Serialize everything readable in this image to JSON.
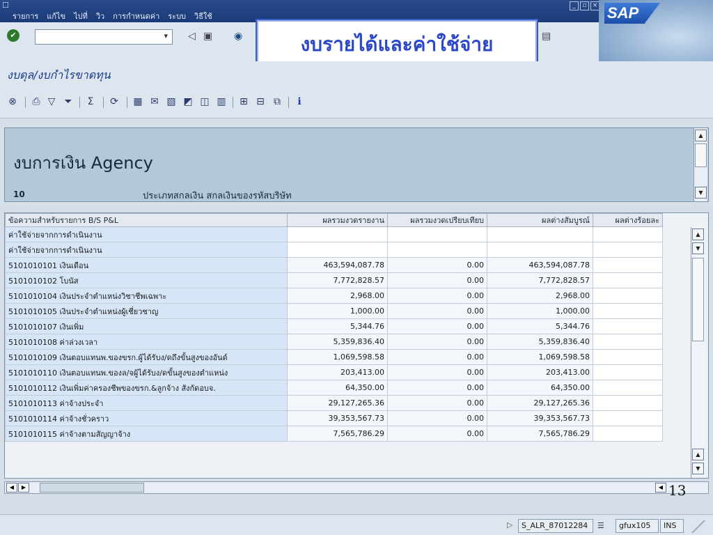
{
  "menu": [
    "รายการ",
    "แก้ไข",
    "ไปที่",
    "วิว",
    "การกำหนดค่า",
    "ระบบ",
    "วิธีใช้"
  ],
  "slide_title": "งบรายได้และค่าใช้จ่าย",
  "screen_title": "งบดุล/งบกำไรขาดทุน",
  "report": {
    "heading": "งบการเงิน Agency",
    "entity_code": "10",
    "entity_desc": "ประเภทสกลเงิน สกลเงินของรหัสบริษัท"
  },
  "table": {
    "columns": [
      "ข้อความสำหรับรายการ B/S P&L",
      "ผลรวมงวดรายงาน",
      "ผลรวมงวดเปรียบเทียบ",
      "ผลต่างสัมบูรณ์",
      "ผลต่างร้อยละ"
    ],
    "rows": [
      {
        "text": "ค่าใช้จ่ายจากการดำเนินงาน",
        "reporting": "",
        "comparison": "",
        "abs_diff": "",
        "pct_diff": ""
      },
      {
        "text": "ค่าใช้จ่ายจากการดำเนินงาน",
        "reporting": "",
        "comparison": "",
        "abs_diff": "",
        "pct_diff": ""
      },
      {
        "text": "5101010101 เงินเดือน",
        "reporting": "463,594,087.78",
        "comparison": "0.00",
        "abs_diff": "463,594,087.78",
        "pct_diff": ""
      },
      {
        "text": "5101010102 โบนัส",
        "reporting": "7,772,828.57",
        "comparison": "0.00",
        "abs_diff": "7,772,828.57",
        "pct_diff": ""
      },
      {
        "text": "5101010104 เงินประจำตำแหน่งวิชาชีพเฉพาะ",
        "reporting": "2,968.00",
        "comparison": "0.00",
        "abs_diff": "2,968.00",
        "pct_diff": ""
      },
      {
        "text": "5101010105 เงินประจำตำแหน่งผู้เชี่ยวชาญ",
        "reporting": "1,000.00",
        "comparison": "0.00",
        "abs_diff": "1,000.00",
        "pct_diff": ""
      },
      {
        "text": "5101010107 เงินเพิ่ม",
        "reporting": "5,344.76",
        "comparison": "0.00",
        "abs_diff": "5,344.76",
        "pct_diff": ""
      },
      {
        "text": "5101010108 ค่าล่วงเวลา",
        "reporting": "5,359,836.40",
        "comparison": "0.00",
        "abs_diff": "5,359,836.40",
        "pct_diff": ""
      },
      {
        "text": "5101010109 เงินตอบแทนพ.ของขรก.ผู้ได้รับง/ดถึงขั้นสูงของอันด์",
        "reporting": "1,069,598.58",
        "comparison": "0.00",
        "abs_diff": "1,069,598.58",
        "pct_diff": ""
      },
      {
        "text": "5101010110 เงินตอบแทนพ.ของล/จผู้ได้รับง/ดขั้นสูงของตำแหน่ง",
        "reporting": "203,413.00",
        "comparison": "0.00",
        "abs_diff": "203,413.00",
        "pct_diff": ""
      },
      {
        "text": "5101010112 เงินเพิ่มค่าครองชีพของขรก.&ลูกจ้าง สังกัดอบจ.",
        "reporting": "64,350.00",
        "comparison": "0.00",
        "abs_diff": "64,350.00",
        "pct_diff": ""
      },
      {
        "text": "5101010113 ค่าจ้างประจำ",
        "reporting": "29,127,265.36",
        "comparison": "0.00",
        "abs_diff": "29,127,265.36",
        "pct_diff": ""
      },
      {
        "text": "5101010114 ค่าจ้างชั่วคราว",
        "reporting": "39,353,567.73",
        "comparison": "0.00",
        "abs_diff": "39,353,567.73",
        "pct_diff": ""
      },
      {
        "text": "5101010115 ค่าจ้างตามสัญญาจ้าง",
        "reporting": "7,565,786.29",
        "comparison": "0.00",
        "abs_diff": "7,565,786.29",
        "pct_diff": ""
      }
    ]
  },
  "slide_number": "13",
  "status": {
    "program": "S_ALR_87012284",
    "client": "gfux105",
    "mode": "INS"
  },
  "colors": {
    "title_blue": "#2a48c8",
    "header_panel": "#b4c8dc",
    "key_cell": "#d6e6f6"
  }
}
